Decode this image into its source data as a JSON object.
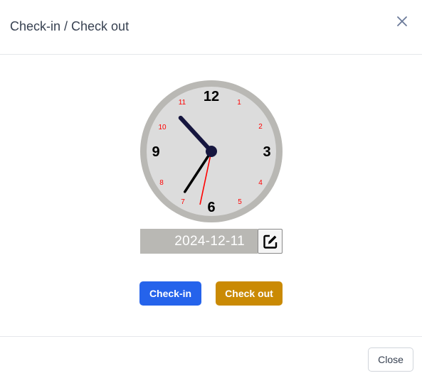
{
  "header": {
    "title": "Check-in / Check out",
    "close_icon": "close-icon"
  },
  "clock": {
    "major_numbers": [
      "12",
      "3",
      "6",
      "9"
    ],
    "minor_numbers": [
      "1",
      "2",
      "4",
      "5",
      "7",
      "8",
      "10",
      "11"
    ],
    "time": {
      "hours": 10,
      "minutes": 35,
      "seconds": 32
    },
    "colors": {
      "rim": "#b9b8b4",
      "face": "#dcdcdc",
      "hour_hand": "#16163f",
      "minute_hand": "#000000",
      "second_hand": "#ff0000",
      "minor_numbers": "#ff0000"
    }
  },
  "date": {
    "value": "2024-12-11",
    "edit_icon": "edit-icon"
  },
  "actions": {
    "checkin_label": "Check-in",
    "checkout_label": "Check out",
    "checkin_color": "#2563eb",
    "checkout_color": "#ca8a04"
  },
  "footer": {
    "close_label": "Close"
  }
}
